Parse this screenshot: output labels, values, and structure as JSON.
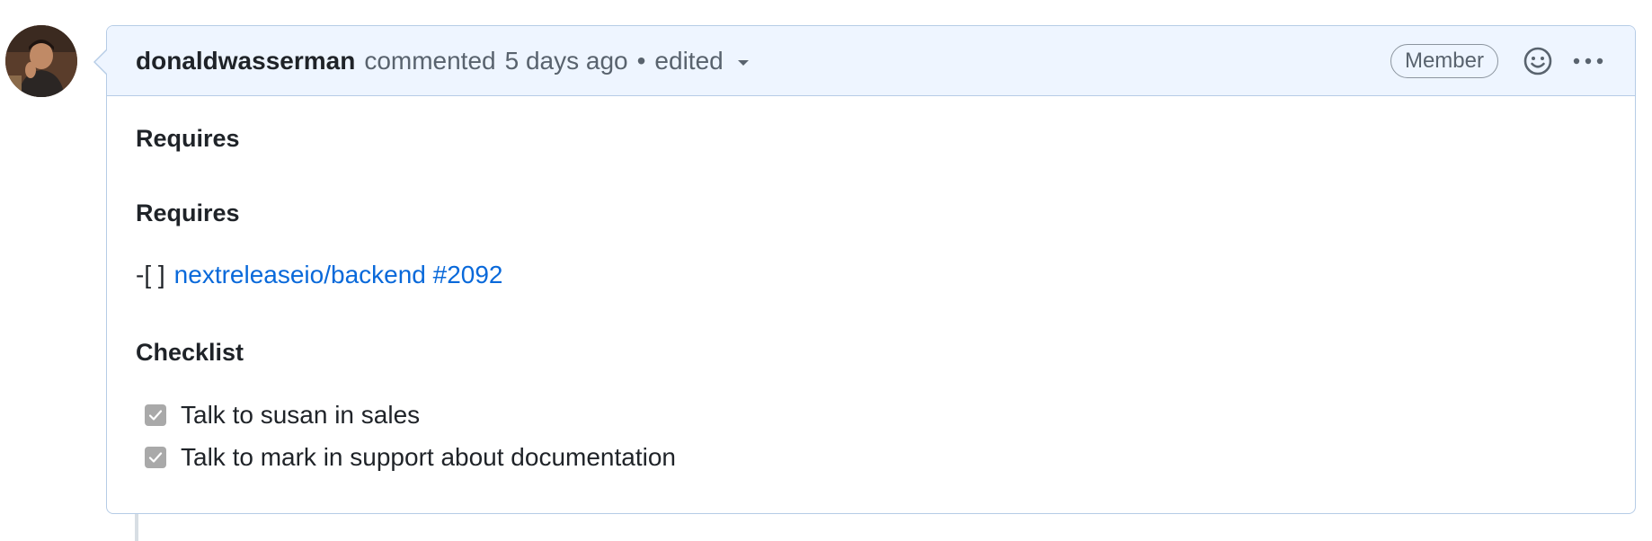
{
  "comment": {
    "author": "donaldwasserman",
    "action": "commented",
    "timestamp": "5 days ago",
    "separator": "•",
    "edited_label": "edited",
    "role_badge": "Member",
    "avatar_icon": "avatar-photo",
    "reaction_icon": "smiley-icon",
    "menu_icon": "kebab-horizontal-icon"
  },
  "body": {
    "heading_1": "Requires",
    "heading_2": "Requires",
    "requires_prefix": "-[ ]",
    "requires_link": "nextreleaseio/backend #2092",
    "heading_3": "Checklist",
    "tasks": [
      {
        "label": "Talk to susan in sales",
        "checked": true
      },
      {
        "label": "Talk to mark in support about documentation",
        "checked": true
      }
    ]
  },
  "colors": {
    "header_bg": "#eef5ff",
    "border": "#b6cce6",
    "link": "#0969da",
    "muted_text": "#59636e",
    "checkbox_fill": "#a9a9a9"
  }
}
